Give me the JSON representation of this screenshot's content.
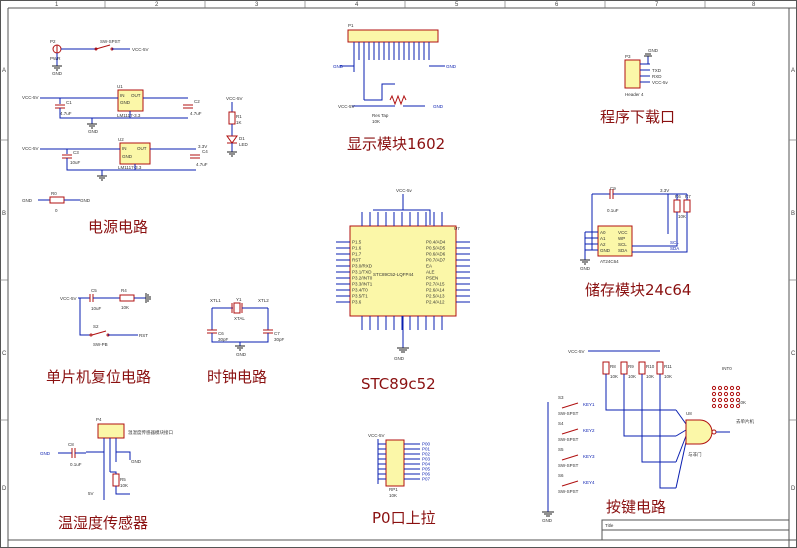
{
  "sheet": {
    "col_labels": [
      "1",
      "2",
      "3",
      "4",
      "5",
      "6",
      "7",
      "8"
    ],
    "row_labels": [
      "A",
      "B",
      "C",
      "D"
    ],
    "title_block": {
      "title_label": "Title"
    }
  },
  "sections": {
    "power": "电源电路",
    "reset": "单片机复位电路",
    "clock": "时钟电路",
    "sensor": "温湿度传感器",
    "display": "显示模块1602",
    "mcu": "STC89c52",
    "p0": "P0口上拉",
    "download": "程序下载口",
    "storage": "储存模块24c64",
    "keys": "按键电路"
  },
  "power": {
    "p2": "P2",
    "p2_pin": "PWR",
    "s1": "SW-SPST",
    "vcc": "VCC-5V",
    "u1": "U1",
    "u1_part": "LM1117-3.3",
    "u2": "U2",
    "u2_part": "LM1117-3.3",
    "c1": "C1",
    "c1_val": "4.7uF",
    "c2": "C2",
    "c2_val": "4.7uF",
    "c3": "C3",
    "c3_val": "10uF",
    "c4": "C4",
    "c4_val": "4.7uF",
    "r1": "R1",
    "r1_val": "1K",
    "d1": "D1",
    "d1_name": "LED",
    "vcc_in": "VCC-5V",
    "out_in": "IN",
    "out_out": "OUT",
    "out_gnd": "GND",
    "gnd": "GND",
    "v33": "3.3V",
    "r_jumper": "R0",
    "jumper_val": "0"
  },
  "display": {
    "p1": "P1",
    "vdd": "VCC-5V",
    "rp": "Res Tap",
    "rp_val": "10K",
    "gnd": "GND"
  },
  "download": {
    "p3": "P3",
    "gnd": "GND",
    "txd": "TXD",
    "rxd": "RXD",
    "vcc": "VCC-5v",
    "header": "Header 4"
  },
  "mcu": {
    "u": "U7",
    "part": "STC89C52-LQFP44",
    "vcc": "VCC-5v",
    "gnd": "GND",
    "left_pins": [
      "P1.5",
      "P1.6",
      "P1.7",
      "RST",
      "P3.0/RXD",
      "P3.1/TXD",
      "P3.2/INT0",
      "P3.3/INT1",
      "P3.4/T0",
      "P3.5/T1",
      "P3.6"
    ],
    "right_pins": [
      "P0.4/AD4",
      "P0.5/AD5",
      "P0.6/AD6",
      "P0.7/AD7",
      "EA",
      "ALE",
      "PSEN",
      "P2.7/A15",
      "P2.6/A14",
      "P2.5/A13",
      "P2.4/A12"
    ]
  },
  "reset": {
    "vcc": "VCC-5V",
    "c": "C5",
    "c_val": "10uF",
    "r": "R4",
    "r_val": "10K",
    "s": "S2",
    "s_val": "SW-PB",
    "rst": "RST",
    "gnd": "GND"
  },
  "clock": {
    "y": "Y1",
    "y_val": "XTAL",
    "xtl1": "XTL1",
    "xtl2": "XTL2",
    "c1": "C6",
    "c1_val": "30pF",
    "c2": "C7",
    "c2_val": "30pF",
    "gnd": "GND"
  },
  "sensor": {
    "u": "P4",
    "desc": "温湿度传感器模块接口",
    "gnd": "GND",
    "vcc": "VCC",
    "c": "C8",
    "c_val": "0.1uF",
    "r": "R5",
    "r_val": "10K",
    "v": "5V"
  },
  "p0": {
    "vcc": "VCC-5V",
    "rp": "RP1",
    "rp_val": "10K",
    "pins": [
      "P00",
      "P01",
      "P02",
      "P03",
      "P04",
      "P05",
      "P06",
      "P07"
    ]
  },
  "storage": {
    "c": "C9",
    "c_val": "0.1uF",
    "vcc": "3.3V",
    "u": "AT24C64",
    "pins_l": [
      "A0",
      "A1",
      "A2",
      "GND"
    ],
    "pins_r": [
      "VCC",
      "WP",
      "SCL",
      "SDA"
    ],
    "r1": "R6",
    "r2": "R7",
    "r_val": "10K",
    "scl": "SCL",
    "sda": "SDA",
    "gnd": "GND"
  },
  "keys": {
    "vcc": "VCC-5V",
    "keys": [
      "KEY1",
      "KEY2",
      "KEY3",
      "KEY4"
    ],
    "switch": "SW-SPST",
    "gate": "U8",
    "gate_desc": "与非门",
    "r_labels": [
      "R8",
      "R9",
      "R10",
      "R11"
    ],
    "r_val": "10K",
    "gnd": "GND",
    "note": "去单片机",
    "int": "INT0"
  },
  "palette": {
    "wire": "#0a1fb0",
    "component": "#b01010",
    "fill": "#fbf7a8",
    "title": "#8a1010"
  }
}
